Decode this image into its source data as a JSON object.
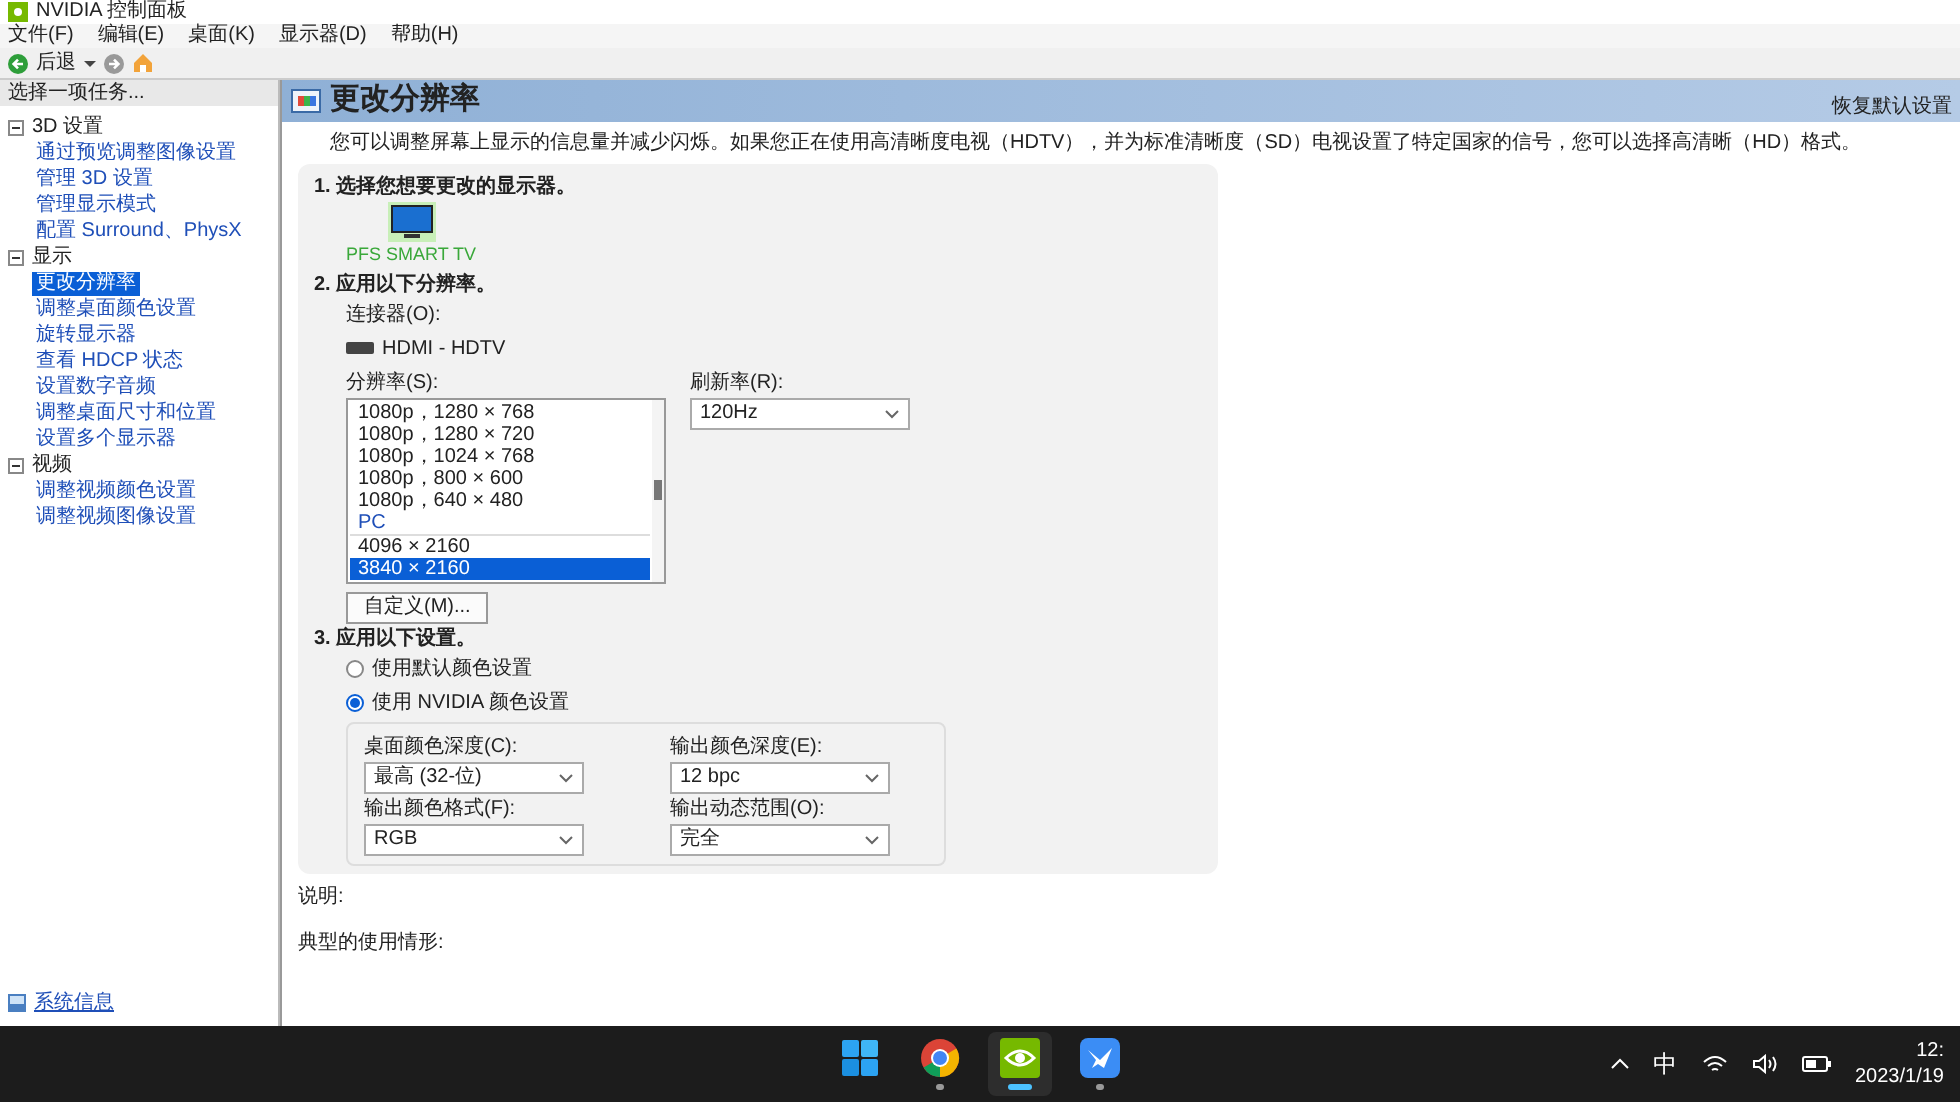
{
  "window": {
    "title": "NVIDIA 控制面板"
  },
  "menu": [
    "文件(F)",
    "编辑(E)",
    "桌面(K)",
    "显示器(D)",
    "帮助(H)"
  ],
  "toolbar": {
    "back": "后退"
  },
  "sidebar": {
    "heading": "选择一项任务...",
    "groups": [
      {
        "label": "3D 设置",
        "expanded": true,
        "children": [
          {
            "label": "通过预览调整图像设置",
            "selected": false
          },
          {
            "label": "管理 3D 设置",
            "selected": false
          },
          {
            "label": "管理显示模式",
            "selected": false
          },
          {
            "label": "配置 Surround、PhysX",
            "selected": false
          }
        ]
      },
      {
        "label": "显示",
        "expanded": true,
        "children": [
          {
            "label": "更改分辨率",
            "selected": true
          },
          {
            "label": "调整桌面颜色设置",
            "selected": false
          },
          {
            "label": "旋转显示器",
            "selected": false
          },
          {
            "label": "查看 HDCP 状态",
            "selected": false
          },
          {
            "label": "设置数字音频",
            "selected": false
          },
          {
            "label": "调整桌面尺寸和位置",
            "selected": false
          },
          {
            "label": "设置多个显示器",
            "selected": false
          }
        ]
      },
      {
        "label": "视频",
        "expanded": true,
        "children": [
          {
            "label": "调整视频颜色设置",
            "selected": false
          },
          {
            "label": "调整视频图像设置",
            "selected": false
          }
        ]
      }
    ],
    "footer": "系统信息"
  },
  "page": {
    "title": "更改分辨率",
    "restore": "恢复默认设置",
    "description": "您可以调整屏幕上显示的信息量并减少闪烁。如果您正在使用高清晰度电视（HDTV），并为标准清晰度（SD）电视设置了特定国家的信号，您可以选择高清晰（HD）格式。",
    "step1": {
      "heading": "1. 选择您想要更改的显示器。",
      "displays": [
        {
          "name": "PFS SMART TV",
          "selected": true
        }
      ]
    },
    "step2": {
      "heading": "2. 应用以下分辨率。",
      "connector_label": "连接器(O):",
      "connector": "HDMI - HDTV",
      "resolution_label": "分辨率(S):",
      "resolutions": [
        {
          "kind": "item",
          "label": "1080p，1280 × 768",
          "selected": false
        },
        {
          "kind": "item",
          "label": "1080p，1280 × 720",
          "selected": false
        },
        {
          "kind": "item",
          "label": "1080p，1024 × 768",
          "selected": false
        },
        {
          "kind": "item",
          "label": "1080p，800 × 600",
          "selected": false
        },
        {
          "kind": "item",
          "label": "1080p，640 × 480",
          "selected": false
        },
        {
          "kind": "header",
          "label": "PC"
        },
        {
          "kind": "item",
          "label": "4096 × 2160",
          "selected": false
        },
        {
          "kind": "item",
          "label": "3840 × 2160",
          "selected": true
        }
      ],
      "refresh_label": "刷新率(R):",
      "refresh": "120Hz",
      "custom_button": "自定义(M)..."
    },
    "step3": {
      "heading": "3. 应用以下设置。",
      "options": [
        {
          "label": "使用默认颜色设置",
          "selected": false
        },
        {
          "label": "使用 NVIDIA 颜色设置",
          "selected": true
        }
      ],
      "settings": [
        {
          "label": "桌面颜色深度(C):",
          "value": "最高 (32-位)"
        },
        {
          "label": "输出颜色深度(E):",
          "value": "12 bpc"
        },
        {
          "label": "输出颜色格式(F):",
          "value": "RGB"
        },
        {
          "label": "输出动态范围(O):",
          "value": "完全"
        }
      ]
    },
    "notes_label": "说明:",
    "usage_label": "典型的使用情形:"
  },
  "taskbar": {
    "apps": [
      {
        "kind": "start",
        "selected": false,
        "running": false
      },
      {
        "kind": "browser",
        "selected": false,
        "running": true
      },
      {
        "kind": "nvidia",
        "selected": true,
        "running": true
      },
      {
        "kind": "bird",
        "selected": false,
        "running": true
      }
    ],
    "ime": "中",
    "time": "12:",
    "date": "2023/1/19"
  }
}
